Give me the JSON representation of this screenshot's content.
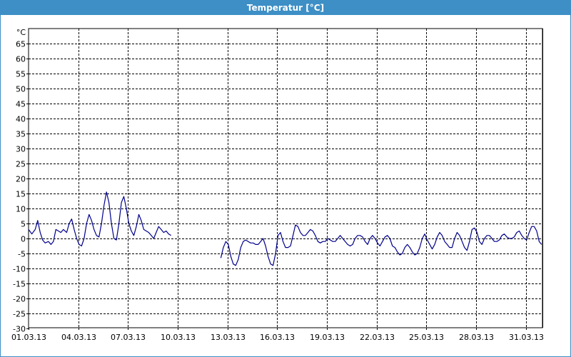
{
  "window": {
    "title": "Temperatur [°C]"
  },
  "chart_data": {
    "type": "line",
    "title": "Temperatur [°C]",
    "xlabel": "",
    "ylabel": "°C",
    "ylim": [
      -30,
      65
    ],
    "yticks": [
      65,
      60,
      55,
      50,
      45,
      40,
      35,
      30,
      25,
      20,
      15,
      10,
      5,
      0,
      -5,
      -10,
      -15,
      -20,
      -25,
      -30
    ],
    "x_tick_labels": [
      "01.03.13",
      "04.03.13",
      "07.03.13",
      "10.03.13",
      "13.03.13",
      "16.03.13",
      "19.03.13",
      "22.03.13",
      "25.03.13",
      "28.03.13",
      "31.03.13"
    ],
    "x_tick_days": [
      0,
      3,
      6,
      9,
      12,
      15,
      18,
      21,
      24,
      27,
      30
    ],
    "xlim_days": [
      0,
      31
    ],
    "grid": true,
    "line_color": "#00008b",
    "series": [
      {
        "segments": [
          [
            [
              0.0,
              3
            ],
            [
              0.2,
              1.5
            ],
            [
              0.4,
              3
            ],
            [
              0.55,
              6
            ],
            [
              0.7,
              2
            ],
            [
              0.85,
              -0.5
            ],
            [
              1.0,
              -1.5
            ],
            [
              1.2,
              -1
            ],
            [
              1.35,
              -2
            ],
            [
              1.5,
              -1
            ],
            [
              1.65,
              3
            ],
            [
              1.8,
              2.5
            ],
            [
              1.95,
              2
            ],
            [
              2.1,
              3
            ],
            [
              2.3,
              2
            ],
            [
              2.45,
              5
            ],
            [
              2.6,
              6.5
            ],
            [
              2.75,
              3
            ],
            [
              2.9,
              0
            ],
            [
              3.05,
              -2
            ],
            [
              3.2,
              -2.5
            ],
            [
              3.35,
              0
            ],
            [
              3.5,
              5
            ],
            [
              3.65,
              8
            ],
            [
              3.8,
              6
            ],
            [
              3.95,
              3
            ],
            [
              4.1,
              1
            ],
            [
              4.25,
              0.5
            ],
            [
              4.4,
              5
            ],
            [
              4.55,
              11
            ],
            [
              4.7,
              15.5
            ],
            [
              4.85,
              12
            ],
            [
              5.0,
              5
            ],
            [
              5.15,
              0
            ],
            [
              5.3,
              -0.5
            ],
            [
              5.45,
              5
            ],
            [
              5.6,
              12
            ],
            [
              5.75,
              14
            ],
            [
              5.9,
              10
            ],
            [
              6.05,
              5
            ],
            [
              6.2,
              2.5
            ],
            [
              6.35,
              1
            ],
            [
              6.5,
              4
            ],
            [
              6.65,
              8
            ],
            [
              6.8,
              6
            ],
            [
              6.95,
              3
            ],
            [
              7.1,
              2.5
            ],
            [
              7.25,
              2
            ],
            [
              7.4,
              1
            ],
            [
              7.55,
              0
            ],
            [
              7.7,
              2
            ],
            [
              7.85,
              4
            ],
            [
              8.0,
              3
            ],
            [
              8.15,
              2
            ],
            [
              8.3,
              2.5
            ],
            [
              8.45,
              1.5
            ],
            [
              8.6,
              1
            ]
          ],
          [
            [
              11.6,
              -6.5
            ],
            [
              11.75,
              -3
            ],
            [
              11.9,
              -1
            ],
            [
              12.05,
              -2
            ],
            [
              12.2,
              -6
            ],
            [
              12.35,
              -8.5
            ],
            [
              12.5,
              -9
            ],
            [
              12.65,
              -7
            ],
            [
              12.8,
              -3
            ],
            [
              12.95,
              -1
            ],
            [
              13.1,
              -0.5
            ],
            [
              13.25,
              -1
            ],
            [
              13.4,
              -1.5
            ],
            [
              13.55,
              -1.5
            ],
            [
              13.7,
              -2
            ],
            [
              13.85,
              -2
            ],
            [
              14.0,
              -1
            ],
            [
              14.15,
              0
            ],
            [
              14.3,
              -2.5
            ],
            [
              14.45,
              -6
            ],
            [
              14.6,
              -8.5
            ],
            [
              14.75,
              -9
            ],
            [
              14.9,
              -5
            ],
            [
              15.05,
              1
            ],
            [
              15.2,
              2
            ],
            [
              15.35,
              -1
            ],
            [
              15.5,
              -3
            ],
            [
              15.65,
              -3
            ],
            [
              15.8,
              -2.5
            ],
            [
              15.95,
              1
            ],
            [
              16.1,
              4.5
            ],
            [
              16.25,
              4
            ],
            [
              16.4,
              2
            ],
            [
              16.55,
              1
            ],
            [
              16.7,
              1
            ],
            [
              16.85,
              2
            ],
            [
              17.0,
              3
            ],
            [
              17.15,
              2.5
            ],
            [
              17.3,
              1
            ],
            [
              17.45,
              -1
            ],
            [
              17.6,
              -1.5
            ],
            [
              17.75,
              -1
            ],
            [
              17.9,
              -1
            ],
            [
              18.05,
              0
            ],
            [
              18.2,
              -0.5
            ],
            [
              18.35,
              -1
            ],
            [
              18.5,
              -1
            ],
            [
              18.65,
              0
            ],
            [
              18.8,
              1
            ],
            [
              18.95,
              0
            ],
            [
              19.1,
              -1
            ],
            [
              19.25,
              -2
            ],
            [
              19.4,
              -2.5
            ],
            [
              19.55,
              -2
            ],
            [
              19.7,
              0
            ],
            [
              19.85,
              1
            ],
            [
              20.0,
              1
            ],
            [
              20.15,
              0.5
            ],
            [
              20.3,
              -1
            ],
            [
              20.45,
              -2
            ],
            [
              20.6,
              0
            ],
            [
              20.75,
              1
            ],
            [
              20.9,
              0
            ],
            [
              21.05,
              -1.5
            ],
            [
              21.2,
              -2.5
            ],
            [
              21.35,
              -1
            ],
            [
              21.5,
              0.5
            ],
            [
              21.65,
              1
            ],
            [
              21.8,
              0
            ],
            [
              21.95,
              -2.5
            ],
            [
              22.1,
              -3
            ],
            [
              22.25,
              -4.5
            ],
            [
              22.4,
              -5.5
            ],
            [
              22.55,
              -5
            ],
            [
              22.7,
              -3
            ],
            [
              22.85,
              -2
            ],
            [
              23.0,
              -3
            ],
            [
              23.15,
              -4.5
            ],
            [
              23.3,
              -5.5
            ],
            [
              23.45,
              -5
            ],
            [
              23.6,
              -3
            ],
            [
              23.75,
              0
            ],
            [
              23.9,
              1.5
            ],
            [
              24.05,
              -0.5
            ],
            [
              24.2,
              -2
            ],
            [
              24.35,
              -3.5
            ],
            [
              24.5,
              -2
            ],
            [
              24.65,
              0.5
            ],
            [
              24.8,
              2
            ],
            [
              24.95,
              1
            ],
            [
              25.1,
              -1
            ],
            [
              25.25,
              -2
            ],
            [
              25.4,
              -3
            ],
            [
              25.55,
              -3
            ],
            [
              25.7,
              0
            ],
            [
              25.85,
              2
            ],
            [
              26.0,
              1
            ],
            [
              26.15,
              -1
            ],
            [
              26.3,
              -3
            ],
            [
              26.45,
              -4
            ],
            [
              26.6,
              -1
            ],
            [
              26.75,
              3
            ],
            [
              26.9,
              3.5
            ],
            [
              27.05,
              2
            ],
            [
              27.2,
              -1
            ],
            [
              27.35,
              -2
            ],
            [
              27.5,
              0
            ],
            [
              27.65,
              1
            ],
            [
              27.8,
              1
            ],
            [
              27.95,
              0
            ],
            [
              28.1,
              -1
            ],
            [
              28.25,
              -1
            ],
            [
              28.4,
              -0.5
            ],
            [
              28.55,
              1
            ],
            [
              28.7,
              1.5
            ],
            [
              28.85,
              0.5
            ],
            [
              29.0,
              0
            ],
            [
              29.15,
              0
            ],
            [
              29.3,
              0.5
            ],
            [
              29.45,
              2
            ],
            [
              29.6,
              2.5
            ],
            [
              29.75,
              1
            ],
            [
              29.9,
              0
            ],
            [
              30.05,
              -0.5
            ],
            [
              30.2,
              2
            ],
            [
              30.35,
              4
            ],
            [
              30.5,
              4
            ],
            [
              30.65,
              2.5
            ],
            [
              30.8,
              -1
            ],
            [
              30.95,
              -2
            ]
          ]
        ]
      }
    ]
  }
}
